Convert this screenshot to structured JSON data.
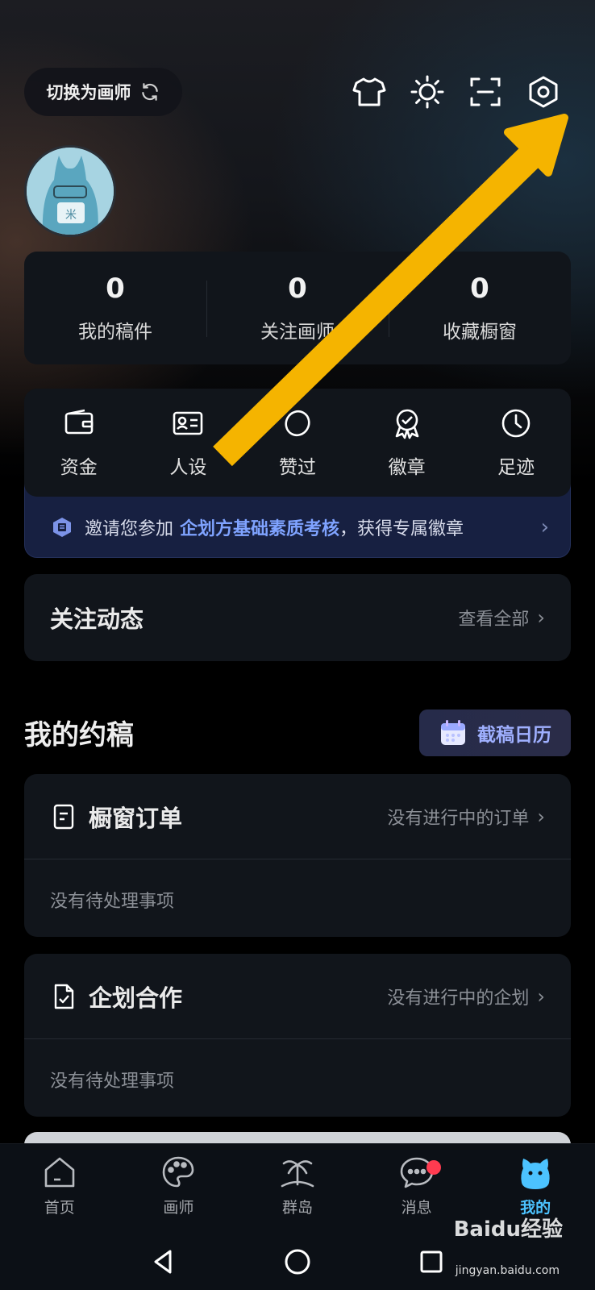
{
  "header": {
    "switch_label": "切换为画师",
    "icons": [
      "shirt-icon",
      "brightness-icon",
      "scan-icon",
      "settings-icon"
    ]
  },
  "stats": [
    {
      "value": "0",
      "label": "我的稿件"
    },
    {
      "value": "0",
      "label": "关注画师"
    },
    {
      "value": "0",
      "label": "收藏橱窗"
    }
  ],
  "tools": [
    {
      "label": "资金",
      "icon": "wallet-icon"
    },
    {
      "label": "人设",
      "icon": "id-card-icon"
    },
    {
      "label": "赞过",
      "icon": "like-icon"
    },
    {
      "label": "徽章",
      "icon": "badge-icon"
    },
    {
      "label": "足迹",
      "icon": "clock-icon"
    }
  ],
  "invite": {
    "prefix": "邀请您参加",
    "highlight": "企划方基础素质考核",
    "suffix": "，获得专属徽章"
  },
  "follow": {
    "title": "关注动态",
    "link": "查看全部"
  },
  "my_commissions": {
    "title": "我的约稿",
    "calendar_button": "截稿日历",
    "cards": [
      {
        "title": "橱窗订单",
        "status": "没有进行中的订单",
        "empty": "没有待处理事项"
      },
      {
        "title": "企划合作",
        "status": "没有进行中的企划",
        "empty": "没有待处理事项"
      }
    ]
  },
  "nav": [
    {
      "label": "首页",
      "icon": "home-icon"
    },
    {
      "label": "画师",
      "icon": "palette-icon"
    },
    {
      "label": "群岛",
      "icon": "island-icon"
    },
    {
      "label": "消息",
      "icon": "message-icon"
    },
    {
      "label": "我的",
      "icon": "mascot-icon",
      "active": true
    }
  ],
  "watermark": {
    "brand": "Baidu经验",
    "url": "jingyan.baidu.com"
  },
  "colors": {
    "accent": "#4cc3ff",
    "highlight": "#7fa3ff",
    "annotation_arrow": "#f5b400"
  }
}
